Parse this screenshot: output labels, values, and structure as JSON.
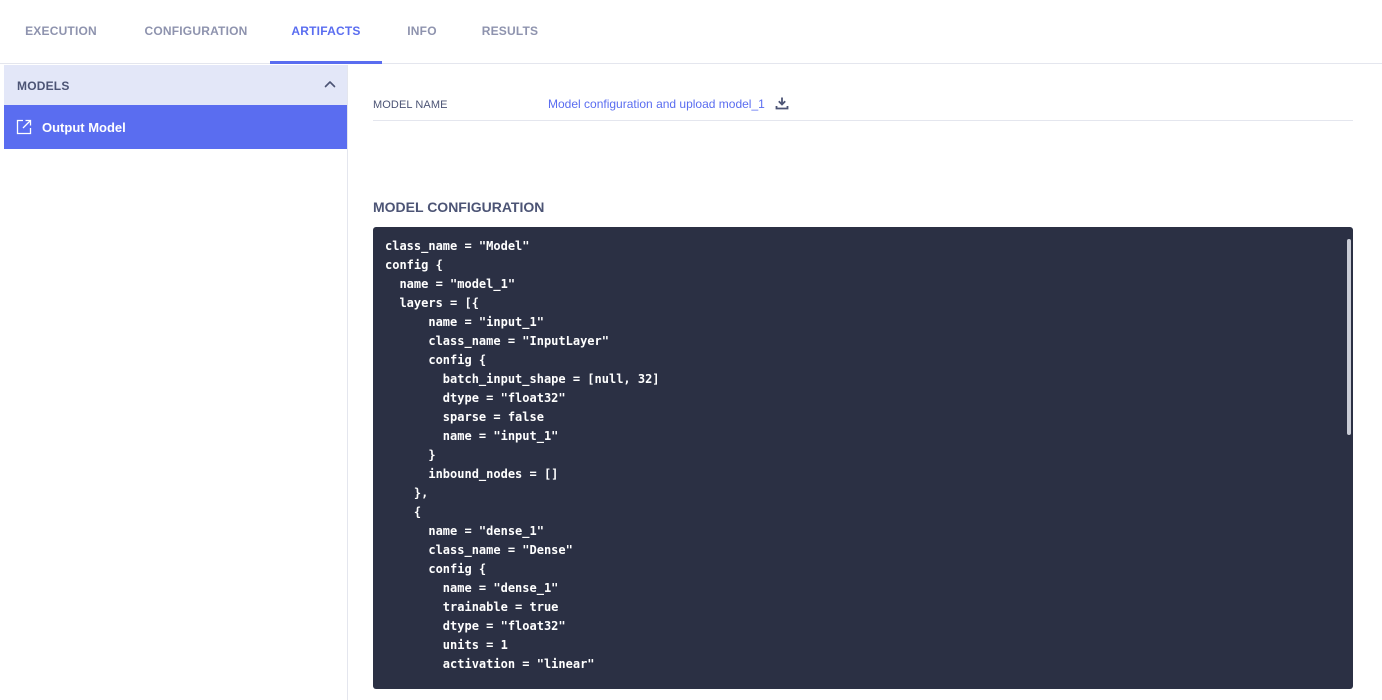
{
  "tabs": [
    {
      "label": "EXECUTION",
      "active": false
    },
    {
      "label": "CONFIGURATION",
      "active": false
    },
    {
      "label": "ARTIFACTS",
      "active": true
    },
    {
      "label": "INFO",
      "active": false
    },
    {
      "label": "RESULTS",
      "active": false
    }
  ],
  "sidebar": {
    "section_title": "MODELS",
    "items": [
      {
        "label": "Output Model",
        "icon": "external-link-icon",
        "selected": true
      }
    ]
  },
  "model": {
    "name_label": "MODEL NAME",
    "name_value": "Model configuration and upload model_1",
    "config_title": "MODEL CONFIGURATION",
    "config_text": "class_name = \"Model\"\nconfig {\n  name = \"model_1\"\n  layers = [{\n      name = \"input_1\"\n      class_name = \"InputLayer\"\n      config {\n        batch_input_shape = [null, 32]\n        dtype = \"float32\"\n        sparse = false\n        name = \"input_1\"\n      }\n      inbound_nodes = []\n    },\n    {\n      name = \"dense_1\"\n      class_name = \"Dense\"\n      config {\n        name = \"dense_1\"\n        trainable = true\n        dtype = \"float32\"\n        units = 1\n        activation = \"linear\""
  },
  "colors": {
    "accent": "#5a6df0",
    "header_bg": "#e3e7f8",
    "code_bg": "#2b3044",
    "muted_text": "#8e93ae",
    "label_text": "#4c5475"
  }
}
